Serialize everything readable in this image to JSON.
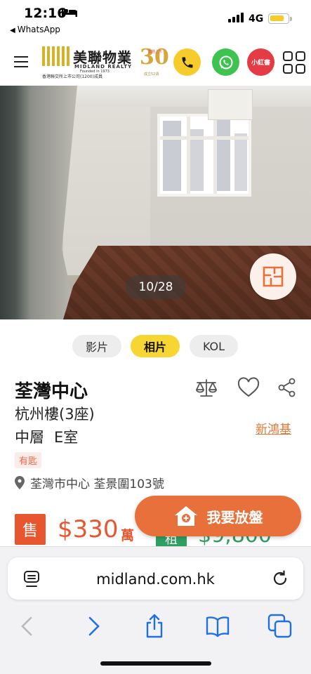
{
  "status_bar": {
    "time": "12:16",
    "back_label": "WhatsApp",
    "network": "4G",
    "battery_level": 0.8,
    "colors": {
      "battery": "#f6cc2c"
    }
  },
  "header": {
    "logo": {
      "name_cn": "美聯物業",
      "name_en": "MIDLAND REALTY",
      "founded": "Founded in 1973",
      "tagline": "香港聯交所上市公司(1200)成員"
    },
    "anniversary": {
      "number": "30",
      "caption": "集團上市",
      "sub": "成立52週"
    },
    "actions": [
      {
        "name": "phone",
        "icon": "phone-icon",
        "color": "#f6cc2c"
      },
      {
        "name": "whatsapp",
        "icon": "whatsapp-icon",
        "color": "#3fc350"
      },
      {
        "name": "xiaohongshu",
        "label": "小紅書",
        "color": "#e43b44"
      },
      {
        "name": "menu-grid",
        "icon": "grid-icon"
      }
    ]
  },
  "gallery": {
    "counter": "10/28",
    "current": 10,
    "total": 28
  },
  "media_tabs": [
    {
      "label": "影片",
      "active": false
    },
    {
      "label": "相片",
      "active": true
    },
    {
      "label": "KOL",
      "active": false
    }
  ],
  "listing": {
    "estate": "荃灣中心",
    "block": "杭州樓(3座)",
    "floor": "中層",
    "unit": "E室",
    "developer": "新鴻基",
    "badge": "有匙",
    "address": "荃灣市中心 荃景圍103號",
    "sale": {
      "tag": "售",
      "price": "$330",
      "unit": "萬"
    },
    "rent": {
      "tag": "租",
      "price": "$9,800"
    },
    "colors": {
      "sale": "#e8562f",
      "rent": "#2f9f62",
      "accent": "#e07a3a"
    }
  },
  "cta": {
    "label": "我要放盤",
    "color": "#e8703a"
  },
  "browser": {
    "url": "midland.com.hk",
    "nav": [
      {
        "name": "back",
        "icon": "chevron-left-icon",
        "enabled": false
      },
      {
        "name": "forward",
        "icon": "chevron-right-icon",
        "enabled": true
      },
      {
        "name": "share",
        "icon": "share-icon",
        "enabled": true
      },
      {
        "name": "bookmarks",
        "icon": "book-icon",
        "enabled": true
      },
      {
        "name": "tabs",
        "icon": "tabs-icon",
        "enabled": true
      }
    ]
  }
}
